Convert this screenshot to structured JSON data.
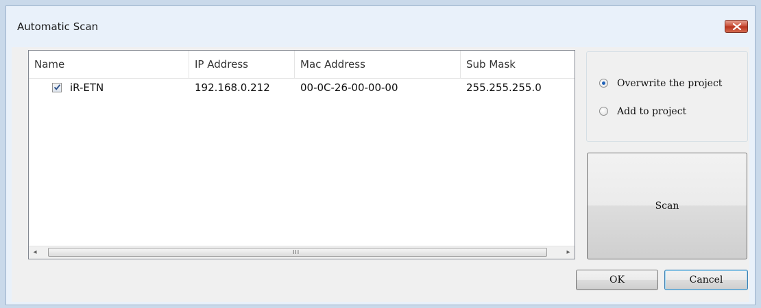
{
  "window": {
    "title": "Automatic Scan",
    "close_icon": "close-x-icon"
  },
  "list": {
    "columns": [
      "Name",
      "IP Address",
      "Mac Address",
      "Sub Mask"
    ],
    "rows": [
      {
        "checked": true,
        "name": "iR-ETN",
        "ip": "192.168.0.212",
        "mac": "00-0C-26-00-00-00",
        "mask": "255.255.255.0"
      }
    ],
    "scroll_left": "◂",
    "scroll_right": "▸",
    "scroll_grip": "III"
  },
  "options": {
    "overwrite_label": "Overwrite the project",
    "add_label": "Add to project",
    "selected": "overwrite"
  },
  "buttons": {
    "scan": "Scan",
    "ok": "OK",
    "cancel": "Cancel"
  }
}
